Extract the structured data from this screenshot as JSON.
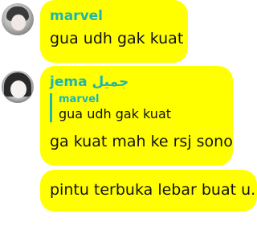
{
  "messages": [
    {
      "sender": "marvel",
      "text": "gua udh gak kuat",
      "avatar_icon": "profile-avatar"
    },
    {
      "sender": "jema جميل",
      "quote": {
        "sender": "marvel",
        "text": "gua udh gak kuat"
      },
      "text": "ga kuat mah ke rsj sono",
      "avatar_icon": "profile-avatar"
    },
    {
      "text": "pintu terbuka lebar buat u."
    }
  ],
  "colors": {
    "bubble": "#ffff00",
    "sender": "#1fb5b0",
    "text": "#111111"
  }
}
